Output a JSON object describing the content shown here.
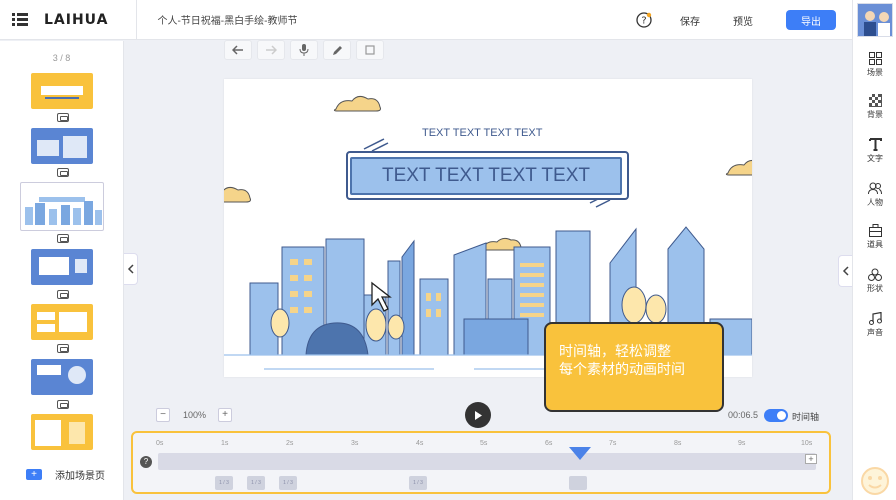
{
  "app": {
    "logo": "LAIHUA",
    "doc_title": "个人-节日祝福-黑白手绘-教师节"
  },
  "header": {
    "save": "保存",
    "preview": "预览",
    "export": "导出"
  },
  "scenes": {
    "page_count": "3 / 8",
    "add_label": "添加场景页",
    "add_icon": "+"
  },
  "toolbar": {
    "icons": [
      "undo-icon",
      "redo-icon",
      "microphone-icon",
      "pencil-icon",
      "square-icon"
    ]
  },
  "canvas": {
    "subtitle": "TEXT TEXT TEXT TEXT",
    "title": "TEXT TEXT TEXT TEXT"
  },
  "tooltip": {
    "line1": "时间轴，轻松调整",
    "line2": "每个素材的动画时间"
  },
  "zoom": {
    "value": "100%",
    "minus": "−",
    "plus": "+"
  },
  "timeline": {
    "current_time": "00:06.5",
    "toggle_label": "时间轴",
    "toggle_on": true,
    "ticks": [
      "0s",
      "1s",
      "2s",
      "3s",
      "4s",
      "5s",
      "6s",
      "7s",
      "8s",
      "9s",
      "10s"
    ],
    "help": "?",
    "plus": "+",
    "chips": [
      "1 / 3",
      "1 / 3",
      "1 / 3",
      "1 / 3"
    ]
  },
  "sidebar": {
    "items": [
      {
        "label": "场景",
        "icon": "scene-grid-icon"
      },
      {
        "label": "背景",
        "icon": "background-icon"
      },
      {
        "label": "文字",
        "icon": "text-icon"
      },
      {
        "label": "人物",
        "icon": "people-icon"
      },
      {
        "label": "道具",
        "icon": "props-icon"
      },
      {
        "label": "形状",
        "icon": "shapes-icon"
      },
      {
        "label": "声音",
        "icon": "music-icon"
      }
    ]
  },
  "colors": {
    "accent": "#3d7ef7",
    "highlight": "#f9c23c",
    "canvas_blue": "#9cc1ec"
  }
}
